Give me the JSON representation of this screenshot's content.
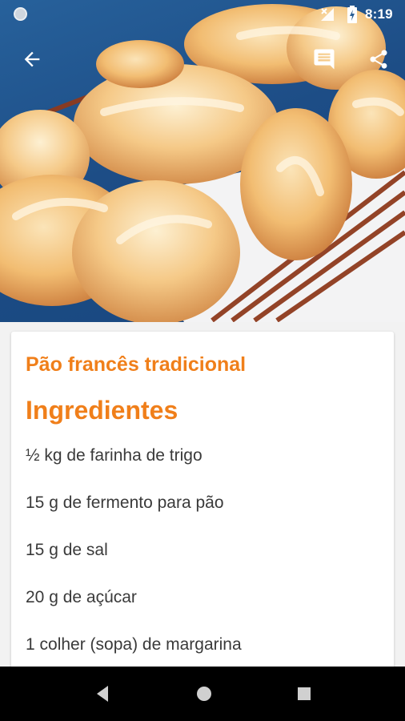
{
  "status_bar": {
    "time": "8:19"
  },
  "toolbar": {
    "back_icon": "arrow-back-icon",
    "comment_icon": "comment-icon",
    "share_icon": "share-icon"
  },
  "recipe": {
    "title": "Pão francês tradicional",
    "ingredients_heading": "Ingredientes",
    "ingredients": [
      "½ kg de farinha de trigo",
      "15 g de fermento para pão",
      "15 g de sal",
      "20 g de açúcar",
      "1 colher (sopa) de margarina"
    ]
  },
  "colors": {
    "accent": "#f07f1a",
    "hero_background": "#1d4d86"
  },
  "nav_bar": {
    "back_icon": "triangle-back-icon",
    "home_icon": "circle-home-icon",
    "recents_icon": "square-recents-icon"
  }
}
